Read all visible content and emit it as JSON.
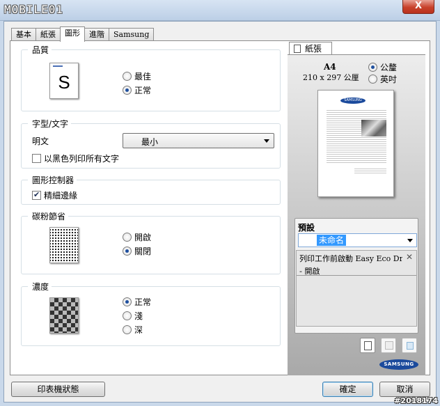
{
  "window": {
    "title_logo": "MOBILE01",
    "close_label": "X"
  },
  "tabs": [
    "基本",
    "紙張",
    "圖形",
    "進階",
    "Samsung"
  ],
  "groups": {
    "quality": {
      "title": "品質",
      "preview_letter": "S",
      "options": [
        {
          "label": "最佳",
          "checked": false
        },
        {
          "label": "正常",
          "checked": true
        }
      ]
    },
    "font": {
      "title": "字型/文字",
      "label": "明文",
      "select_value": "最小",
      "checkbox_label": "以黑色列印所有文字",
      "checkbox_checked": false
    },
    "graphics": {
      "title": "圖形控制器",
      "checkbox_label": "精細邊緣",
      "checkbox_checked": true
    },
    "toner": {
      "title": "碳粉節省",
      "options": [
        {
          "label": "開啟",
          "checked": false
        },
        {
          "label": "關閉",
          "checked": true
        }
      ]
    },
    "density": {
      "title": "濃度",
      "options": [
        {
          "label": "正常",
          "checked": true
        },
        {
          "label": "淺",
          "checked": false
        },
        {
          "label": "深",
          "checked": false
        }
      ]
    }
  },
  "paper_panel": {
    "tab_label": "紙張",
    "size_name": "A4",
    "size_dims": "210 x 297 公厘",
    "unit_metric": "公釐",
    "unit_metric_checked": true,
    "unit_inch": "英吋",
    "unit_inch_checked": false,
    "preview_logo": "SAMSUNG"
  },
  "preset": {
    "title": "預設",
    "select_value": "未命名",
    "item_title": "列印工作前啟動 Easy Eco Dri...",
    "item_value": "- 開啟"
  },
  "brand_logo": "SAMSUNG",
  "footer": {
    "status_button": "印表機狀態",
    "ok_button": "確定",
    "cancel_button": "取消"
  },
  "watermark": "#2018174"
}
